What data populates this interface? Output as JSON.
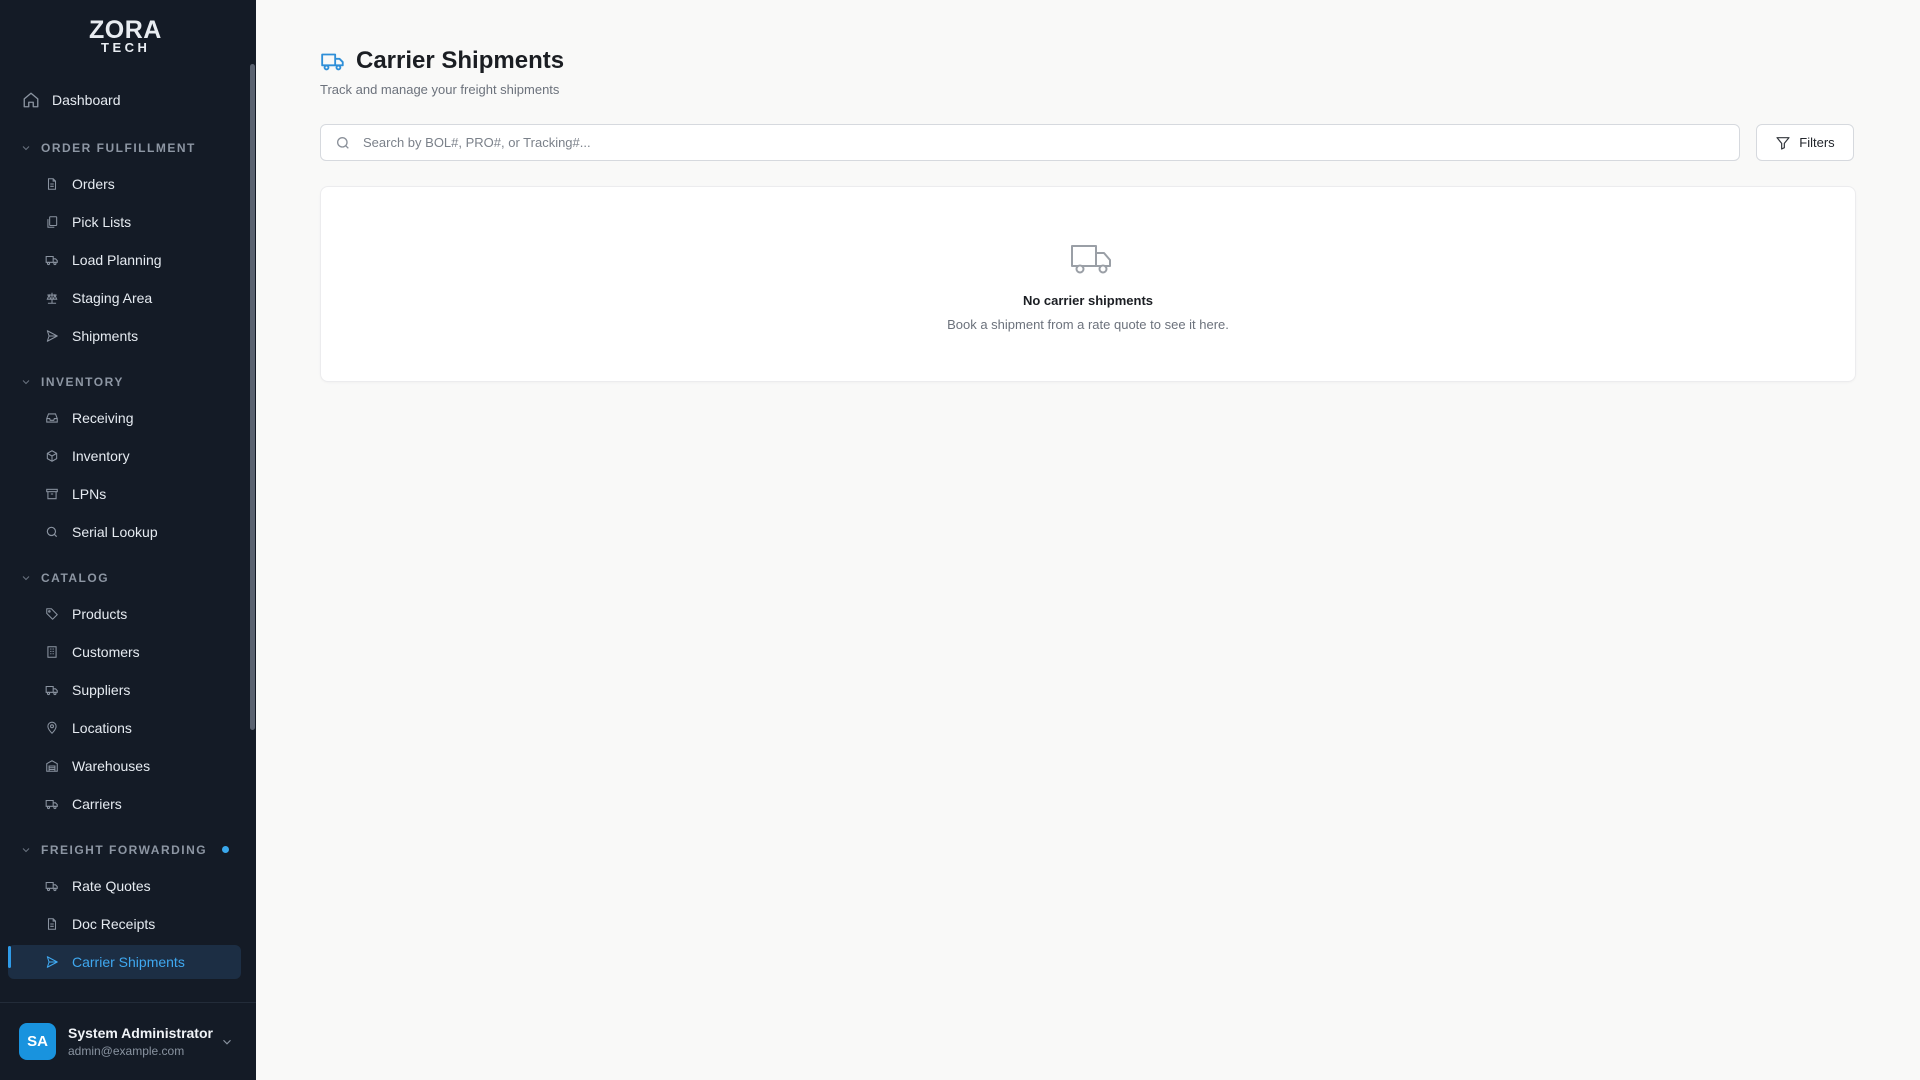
{
  "brand": {
    "line1": "ZORA",
    "line2": "TECH"
  },
  "sidebar": {
    "dashboard": {
      "label": "Dashboard",
      "icon": "home-icon"
    },
    "sections": [
      {
        "title": "ORDER FULFILLMENT",
        "items": [
          {
            "label": "Orders",
            "icon": "file-icon"
          },
          {
            "label": "Pick Lists",
            "icon": "clipboard-icon"
          },
          {
            "label": "Load Planning",
            "icon": "truck-icon"
          },
          {
            "label": "Staging Area",
            "icon": "scale-icon"
          },
          {
            "label": "Shipments",
            "icon": "send-icon"
          }
        ]
      },
      {
        "title": "INVENTORY",
        "items": [
          {
            "label": "Receiving",
            "icon": "inbox-icon"
          },
          {
            "label": "Inventory",
            "icon": "box-icon"
          },
          {
            "label": "LPNs",
            "icon": "archive-icon"
          },
          {
            "label": "Serial Lookup",
            "icon": "search-icon"
          }
        ]
      },
      {
        "title": "CATALOG",
        "items": [
          {
            "label": "Products",
            "icon": "tag-icon"
          },
          {
            "label": "Customers",
            "icon": "building-icon"
          },
          {
            "label": "Suppliers",
            "icon": "truck-icon"
          },
          {
            "label": "Locations",
            "icon": "map-pin-icon"
          },
          {
            "label": "Warehouses",
            "icon": "warehouse-icon"
          },
          {
            "label": "Carriers",
            "icon": "truck-icon"
          }
        ]
      },
      {
        "title": "FREIGHT FORWARDING",
        "items": [
          {
            "label": "Rate Quotes",
            "icon": "truck-icon"
          },
          {
            "label": "Doc Receipts",
            "icon": "file-icon"
          },
          {
            "label": "Carrier Shipments",
            "icon": "send-icon"
          }
        ]
      }
    ],
    "active_item": "Carrier Shipments",
    "user": {
      "initials": "SA",
      "name": "System Administrator",
      "email": "admin@example.com"
    }
  },
  "page": {
    "title": "Carrier Shipments",
    "title_icon": "truck-icon",
    "subtitle": "Track and manage your freight shipments",
    "search": {
      "placeholder": "Search by BOL#, PRO#, or Tracking#...",
      "value": ""
    },
    "filters_label": "Filters",
    "empty_state": {
      "icon": "truck-icon",
      "title": "No carrier shipments",
      "text": "Book a shipment from a rate quote to see it here."
    }
  },
  "colors": {
    "sidebar_bg": "#141b26",
    "accent": "#2f9be8",
    "page_bg": "#f9f9f8"
  }
}
